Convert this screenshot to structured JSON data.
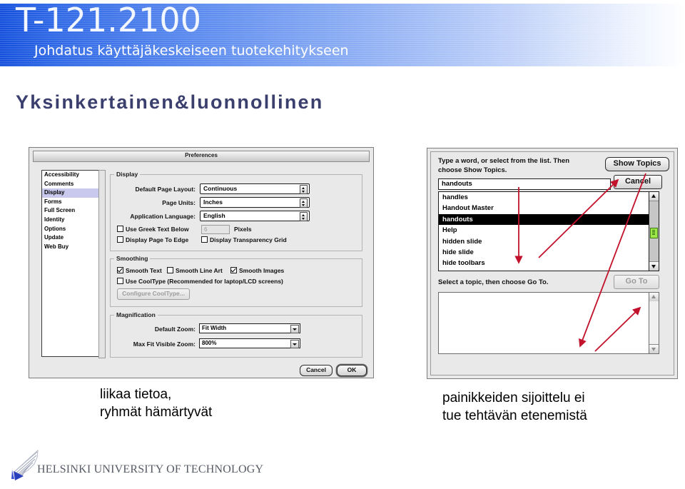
{
  "header": {
    "course_code": "T-121.2100",
    "course_subtitle": "Johdatus käyttäjäkeskeiseen tuotekehitykseen"
  },
  "slide": {
    "title": "Yksinkertainen&luonnollinen"
  },
  "preferences_dialog": {
    "window_title": "Preferences",
    "category_list": [
      {
        "label": "Accessibility",
        "selected": false
      },
      {
        "label": "Comments",
        "selected": false
      },
      {
        "label": "Display",
        "selected": true
      },
      {
        "label": "Forms",
        "selected": false
      },
      {
        "label": "Full Screen",
        "selected": false
      },
      {
        "label": "Identity",
        "selected": false
      },
      {
        "label": "Options",
        "selected": false
      },
      {
        "label": "Update",
        "selected": false
      },
      {
        "label": "Web Buy",
        "selected": false
      }
    ],
    "display_group": {
      "legend": "Display",
      "default_page_layout_label": "Default Page Layout:",
      "default_page_layout_value": "Continuous",
      "page_units_label": "Page Units:",
      "page_units_value": "Inches",
      "application_language_label": "Application Language:",
      "application_language_value": "English",
      "use_greek_text_label": "Use Greek Text Below",
      "use_greek_text_value": "6",
      "pixels_label": "Pixels",
      "display_page_to_edge_label": "Display Page To Edge",
      "display_transparency_grid_label": "Display Transparency Grid"
    },
    "smoothing_group": {
      "legend": "Smoothing",
      "smooth_text_label": "Smooth Text",
      "smooth_line_art_label": "Smooth Line Art",
      "smooth_images_label": "Smooth Images",
      "use_cooltype_label": "Use CoolType (Recommended for laptop/LCD screens)",
      "configure_cooltype_label": "Configure CoolType..."
    },
    "magnification_group": {
      "legend": "Magnification",
      "default_zoom_label": "Default Zoom:",
      "default_zoom_value": "Fit Width",
      "max_fit_visible_zoom_label": "Max Fit Visible Zoom:",
      "max_fit_visible_zoom_value": "800%"
    },
    "cancel_label": "Cancel",
    "ok_label": "OK"
  },
  "help_dialog": {
    "prompt": "Type a word, or select from the list. Then choose Show Topics.",
    "search_value": "handouts",
    "show_topics_label": "Show Topics",
    "cancel_label": "Cancel",
    "topic_list": [
      {
        "label": "handles",
        "selected": false
      },
      {
        "label": "Handout Master",
        "selected": false
      },
      {
        "label": "handouts",
        "selected": true
      },
      {
        "label": "Help",
        "selected": false
      },
      {
        "label": "hidden slide",
        "selected": false
      },
      {
        "label": "hide slide",
        "selected": false
      },
      {
        "label": "hide toolbars",
        "selected": false
      }
    ],
    "sub_prompt": "Select a topic, then choose Go To.",
    "go_to_label": "Go To"
  },
  "captions": {
    "left_line1": "liikaa tietoa,",
    "left_line2": "ryhmät hämärtyvät",
    "right_line1": "painikkeiden sijoittelu ei",
    "right_line2": "tue tehtävän etenemistä"
  },
  "footer": {
    "organisation": "HELSINKI UNIVERSITY OF TECHNOLOGY"
  },
  "colors": {
    "header_blue": "#1450dc",
    "title_navy": "#3b3f6e",
    "annotation_red": "#c2122b",
    "selection_lilac": "#c9c9ee",
    "scroll_marker_green": "#9ee84a"
  }
}
